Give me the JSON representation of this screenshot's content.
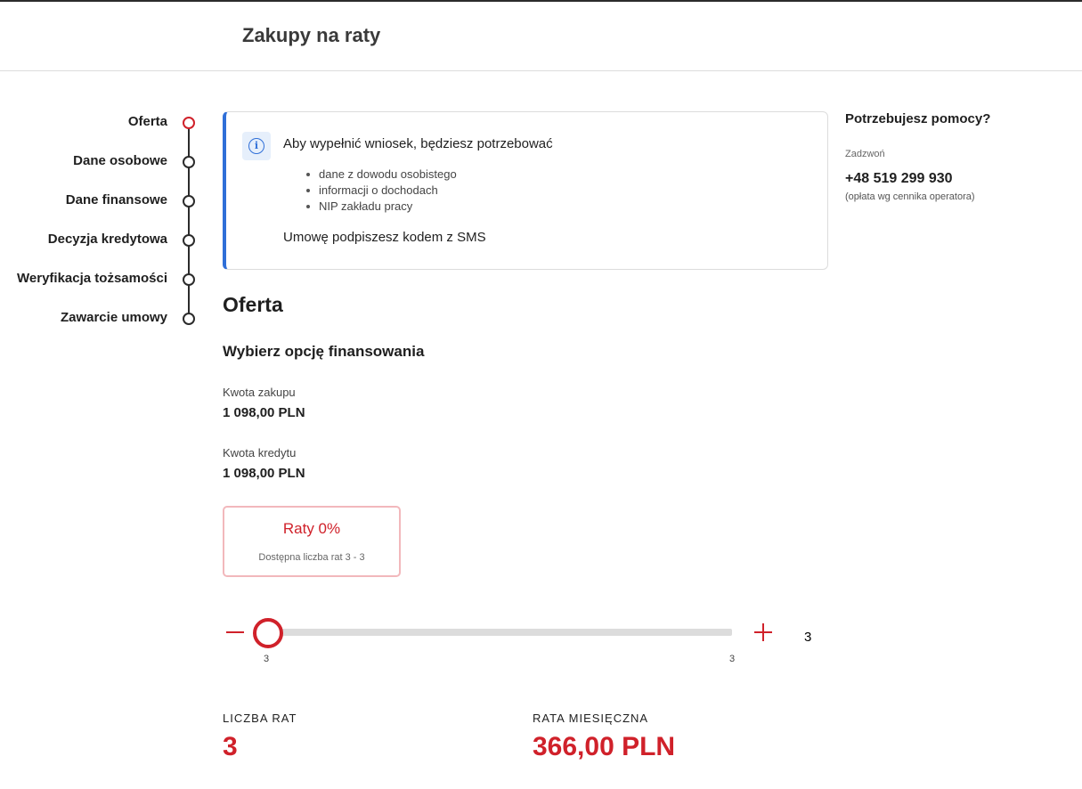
{
  "header": {
    "title": "Zakupy na raty"
  },
  "stepper": {
    "steps": [
      {
        "label": "Oferta",
        "state": "active"
      },
      {
        "label": "Dane osobowe",
        "state": "pending"
      },
      {
        "label": "Dane finansowe",
        "state": "pending"
      },
      {
        "label": "Decyzja kredytowa",
        "state": "pending"
      },
      {
        "label": "Weryfikacja tożsamości",
        "state": "pending"
      },
      {
        "label": "Zawarcie umowy",
        "state": "pending"
      }
    ]
  },
  "info": {
    "icon": "info-icon",
    "heading": "Aby wypełnić wniosek, będziesz potrzebować",
    "items": [
      "dane z dowodu osobistego",
      "informacji o dochodach",
      "NIP zakładu pracy"
    ],
    "footer": "Umowę podpiszesz kodem z SMS"
  },
  "help": {
    "title": "Potrzebujesz pomocy?",
    "call_label": "Zadzwoń",
    "phone": "+48 519 299 930",
    "note": "(opłata wg cennika operatora)"
  },
  "offer": {
    "title": "Oferta",
    "subtitle": "Wybierz opcję finansowania",
    "purchase_label": "Kwota zakupu",
    "purchase_value": "1 098,00 PLN",
    "credit_label": "Kwota kredytu",
    "credit_value": "1 098,00 PLN",
    "option": {
      "title": "Raty 0%",
      "description": "Dostępna liczba rat 3 - 3"
    },
    "slider": {
      "min_label": "3",
      "max_label": "3",
      "value": "3",
      "fraction": 0
    },
    "installments_label": "LICZBA RAT",
    "installments_value": "3",
    "monthly_label": "RATA MIESIĘCZNA",
    "monthly_value": "366,00 PLN"
  },
  "colors": {
    "accent": "#d0212a",
    "info": "#2f6fd8",
    "card_border": "#f2b8bc"
  }
}
